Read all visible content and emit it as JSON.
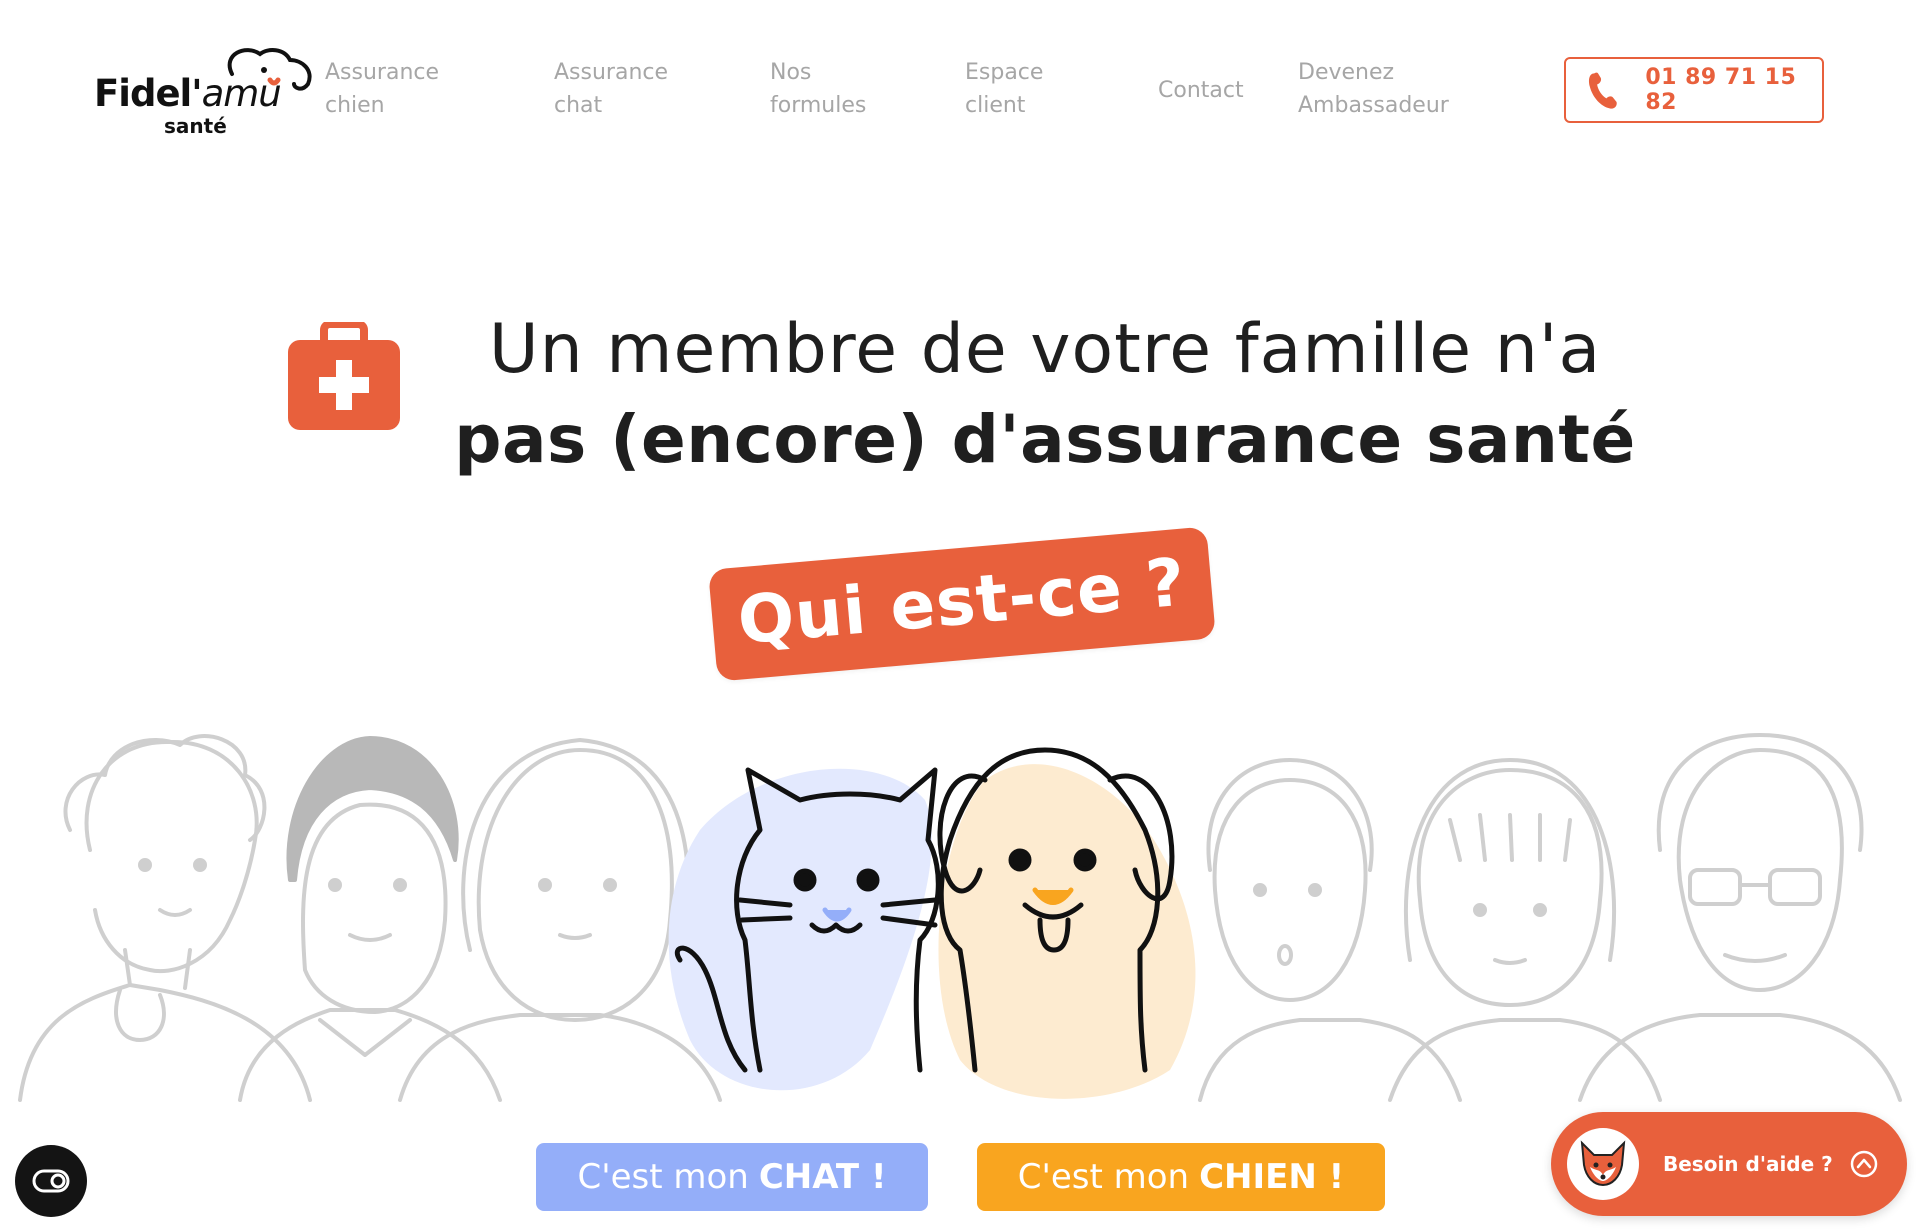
{
  "brand": {
    "name": "Fidel'amu",
    "name_prefix": "Fidel'",
    "name_suffix": "amu",
    "sub": "santé",
    "accent": "#e8603c"
  },
  "nav": {
    "items": [
      {
        "line1": "Assurance",
        "line2": "chien"
      },
      {
        "line1": "Assurance",
        "line2": "chat"
      },
      {
        "line1": "Nos",
        "line2": "formules"
      },
      {
        "line1": "Espace",
        "line2": "client"
      },
      {
        "line1": "Contact",
        "line2": ""
      },
      {
        "line1": "Devenez",
        "line2": "Ambassadeur"
      }
    ],
    "phone": "01 89 71 15 82",
    "phone_icon": "phone-icon"
  },
  "hero": {
    "icon": "first-aid-kit-icon",
    "line1": "Un membre de votre famille n'a",
    "line2": "pas (encore) d'assurance santé",
    "tag": "Qui est-ce ?"
  },
  "cta": {
    "cat_prefix": "C'est mon",
    "cat_strong": "CHAT !",
    "cat_color": "#94aef9",
    "dog_prefix": "C'est mon",
    "dog_strong": "CHIEN !",
    "dog_color": "#f9a51f"
  },
  "widgets": {
    "accessibility_icon": "accessibility-toggle-icon",
    "help_label": "Besoin d'aide ?",
    "help_avatar": "fox-avatar-icon"
  }
}
